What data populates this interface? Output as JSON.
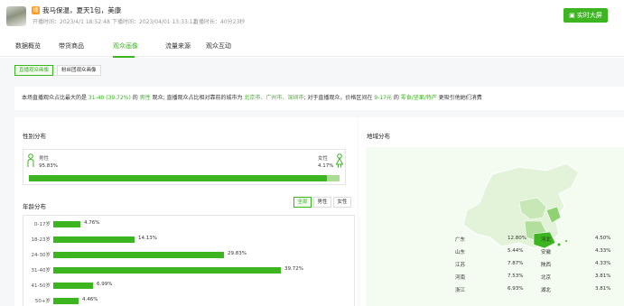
{
  "header": {
    "title": "我马保温，夏天1包，美康",
    "start_time": "开播时间：2023/4/1 18:52:48",
    "end_time": "下播时间：2023/04/01 13:33:12",
    "duration": "直播时长：40分23秒",
    "big_screen_label": "实时大屏"
  },
  "tabs": [
    "数据概览",
    "带货商品",
    "观众画像",
    "流量来源",
    "观众互动"
  ],
  "active_tab": "观众画像",
  "subtabs": [
    "直播观众画像",
    "粉丝团观众画像"
  ],
  "summary": {
    "p1": "本场直播观众占比最大的是 ",
    "age": "31-40 (39.72%)",
    "p2": " 的 ",
    "gender": "男性",
    "p3": " 观众; 直播观众占比相对靠前的城市为 ",
    "cities": "北京市、广州市、深圳市",
    "p4": "; 对于直播观众，价格区间在 ",
    "price": "9-17元",
    "p5": " 的 ",
    "category": "零食/坚果/特产",
    "p6": " 更吸引他她们消费"
  },
  "gender": {
    "title": "性别分布",
    "male_label": "男性",
    "male_value": "95.83%",
    "female_label": "女性",
    "female_value": "4.17%",
    "male_fraction": 0.9583
  },
  "age": {
    "title": "年龄分布",
    "filters": [
      "全部",
      "男性",
      "女性"
    ],
    "active_filter": "全部",
    "rows": [
      {
        "label": "0-17岁",
        "value": "4.76%",
        "pct": 4.76
      },
      {
        "label": "18-23岁",
        "value": "14.13%",
        "pct": 14.13
      },
      {
        "label": "24-30岁",
        "value": "29.83%",
        "pct": 29.83
      },
      {
        "label": "31-40岁",
        "value": "39.72%",
        "pct": 39.72
      },
      {
        "label": "41-50岁",
        "value": "6.99%",
        "pct": 6.99
      },
      {
        "label": "50+岁",
        "value": "4.46%",
        "pct": 4.46
      }
    ]
  },
  "region": {
    "title": "地域分布",
    "left": [
      {
        "name": "广东",
        "value": "12.80%"
      },
      {
        "name": "山东",
        "value": "5.44%"
      },
      {
        "name": "江苏",
        "value": "7.87%"
      },
      {
        "name": "河南",
        "value": "7.53%"
      },
      {
        "name": "浙江",
        "value": "6.93%"
      }
    ],
    "right": [
      {
        "name": "河北",
        "value": "4.50%"
      },
      {
        "name": "安徽",
        "value": "4.33%"
      },
      {
        "name": "陕西",
        "value": "4.33%"
      },
      {
        "name": "北京",
        "value": "3.81%"
      },
      {
        "name": "湖北",
        "value": "3.81%"
      }
    ]
  },
  "colors": {
    "accent": "#3cb521",
    "accent_light": "#a8dd93",
    "badge": "#ff9a1f"
  }
}
